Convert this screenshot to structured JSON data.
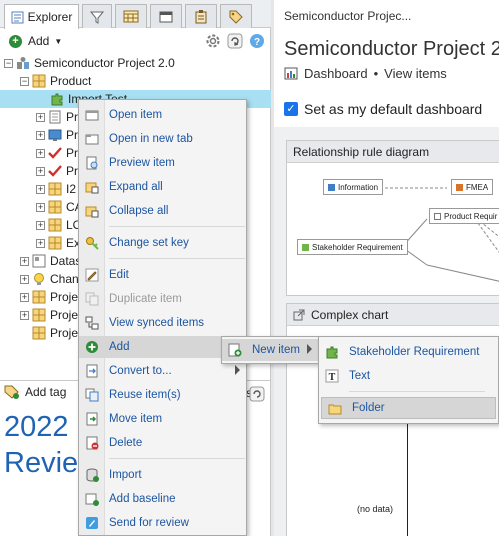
{
  "explorer": {
    "tab_label": "Explorer",
    "add_label": "Add",
    "tree": [
      {
        "label": "Semiconductor Project 2.0"
      },
      {
        "label": "Product"
      },
      {
        "label": "Import Test"
      },
      {
        "label": "Pr"
      },
      {
        "label": "Pr"
      },
      {
        "label": "Pr"
      },
      {
        "label": "Pr"
      },
      {
        "label": "I2"
      },
      {
        "label": "CA"
      },
      {
        "label": "LO"
      },
      {
        "label": "Ex"
      },
      {
        "label": "Datas"
      },
      {
        "label": "Chan"
      },
      {
        "label": "Proje"
      },
      {
        "label": "Proje"
      },
      {
        "label": "Proje"
      }
    ],
    "tree_overflow_text": "n",
    "add_tag_label": "Add tag",
    "st_text": "st",
    "big_text_1": "2022",
    "big_text_2": "Review"
  },
  "main": {
    "breadcrumb": "Semiconductor Projec...",
    "title": "Semiconductor Project 2.0",
    "subnav": {
      "dashboard": "Dashboard",
      "separator": "•",
      "view_items": "View items"
    },
    "default_checkbox_label": "Set as my default dashboard",
    "widgets": {
      "relationship": {
        "title": "Relationship rule diagram",
        "nodes": {
          "information": "Information",
          "fmea": "FMEA",
          "product_requ": "Product Requir",
          "stakeholder": "Stakeholder Requirement"
        }
      },
      "complex": {
        "title": "Complex chart",
        "no_data": "(no data)"
      }
    }
  },
  "context_menu": {
    "items": [
      {
        "label": "Open item",
        "enabled": true
      },
      {
        "label": "Open in new tab",
        "enabled": true
      },
      {
        "label": "Preview item",
        "enabled": true
      },
      {
        "label": "Expand all",
        "enabled": true
      },
      {
        "label": "Collapse all",
        "enabled": true
      },
      {
        "label": "Change set key",
        "enabled": true
      },
      {
        "label": "Edit",
        "enabled": true
      },
      {
        "label": "Duplicate item",
        "enabled": false
      },
      {
        "label": "View synced items",
        "enabled": true
      },
      {
        "label": "Add",
        "enabled": true
      },
      {
        "label": "Convert to...",
        "enabled": true
      },
      {
        "label": "Reuse item(s)",
        "enabled": true
      },
      {
        "label": "Move item",
        "enabled": true
      },
      {
        "label": "Delete",
        "enabled": true
      },
      {
        "label": "Import",
        "enabled": true
      },
      {
        "label": "Add baseline",
        "enabled": true
      },
      {
        "label": "Send for review",
        "enabled": true
      }
    ],
    "submenu_add": {
      "new_item": "New item"
    },
    "submenu_new_item": [
      "Stakeholder Requirement",
      "Text",
      "Folder"
    ]
  },
  "colors": {
    "accent": "#1f63b5",
    "selection": "#a9dff2",
    "menu_hover": "#d6d6d6",
    "checkbox": "#1a73e8"
  }
}
